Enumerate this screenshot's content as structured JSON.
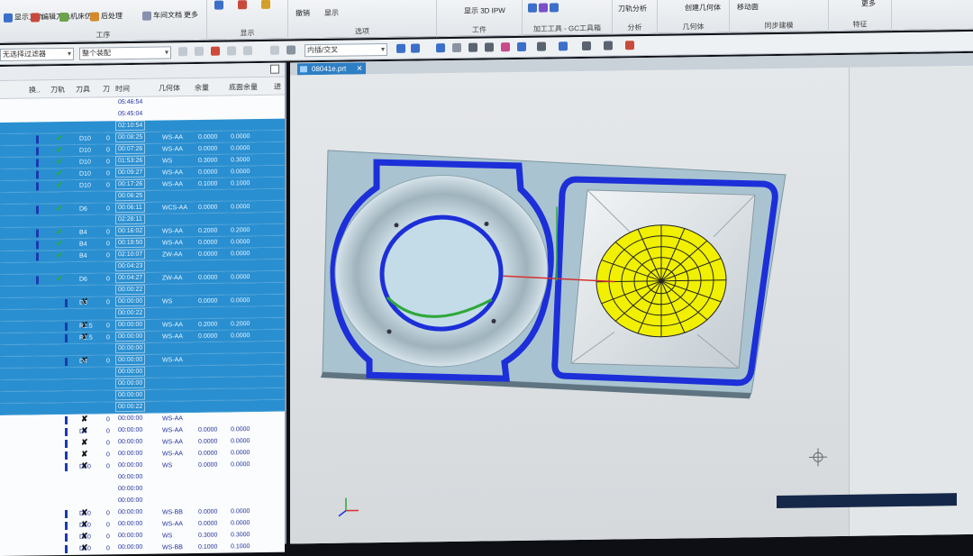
{
  "ribbon": {
    "groups": [
      {
        "name": "工序",
        "buttons": [
          "显示刀轨",
          "编辑刀轨",
          "机床仿真",
          "后处理",
          "车间文档",
          "更多"
        ]
      },
      {
        "name": "显示",
        "buttons": []
      },
      {
        "name": "选项",
        "buttons": [
          "撤销",
          "显示"
        ]
      },
      {
        "name": "工件",
        "buttons": [
          "显示 3D IPW"
        ]
      },
      {
        "name": "加工工具 - GC工具箱",
        "buttons": []
      },
      {
        "name": "分析",
        "buttons": [
          "刀轨分析"
        ]
      },
      {
        "name": "几何体",
        "buttons": [
          "创建几何体"
        ]
      },
      {
        "name": "同步建模",
        "buttons": [
          "移动面"
        ]
      },
      {
        "name": "特征",
        "buttons": [
          "更多"
        ]
      }
    ]
  },
  "toolbar": {
    "filter_value": "无选择过滤器",
    "assembly_value": "整个装配",
    "snap_value": "内插/交叉"
  },
  "navigator": {
    "columns": [
      "换..",
      "刀轨",
      "刀具",
      "刀",
      "时间",
      "几何体",
      "余量",
      "底面余量",
      "进"
    ],
    "rows": [
      {
        "sel": false,
        "time": "05:46:54",
        "mark": "",
        "tool": "",
        "n": "",
        "geo": "",
        "a": "",
        "b": ""
      },
      {
        "sel": false,
        "time": "05:45:04",
        "mark": "",
        "tool": "",
        "n": "",
        "geo": "",
        "a": "",
        "b": ""
      },
      {
        "sel": true,
        "time": "02:10:54",
        "mark": "",
        "tool": "",
        "n": "",
        "geo": "",
        "a": "",
        "b": ""
      },
      {
        "sel": true,
        "time": "00:08:25",
        "mark": "check",
        "tool": "D10",
        "n": "0",
        "geo": "WS-AA",
        "a": "0.0000",
        "b": "0.0000"
      },
      {
        "sel": true,
        "time": "00:07:26",
        "mark": "check",
        "tool": "D10",
        "n": "0",
        "geo": "WS-AA",
        "a": "0.0000",
        "b": "0.0000"
      },
      {
        "sel": true,
        "time": "01:53:26",
        "mark": "check",
        "tool": "D10",
        "n": "0",
        "geo": "WS",
        "a": "0.3000",
        "b": "0.3000"
      },
      {
        "sel": true,
        "time": "00:09:27",
        "mark": "check",
        "tool": "D10",
        "n": "0",
        "geo": "WS-AA",
        "a": "0.0000",
        "b": "0.0000"
      },
      {
        "sel": true,
        "time": "00:17:26",
        "mark": "check",
        "tool": "D10",
        "n": "0",
        "geo": "WS-AA",
        "a": "0.1000",
        "b": "0.1000"
      },
      {
        "sel": true,
        "time": "00:06:25",
        "mark": "",
        "tool": "",
        "n": "",
        "geo": "",
        "a": "",
        "b": ""
      },
      {
        "sel": true,
        "time": "00:06:11",
        "mark": "check",
        "tool": "D6",
        "n": "0",
        "geo": "WCS-AA",
        "a": "0.0000",
        "b": "0.0000"
      },
      {
        "sel": true,
        "time": "02:28:11",
        "mark": "",
        "tool": "",
        "n": "",
        "geo": "",
        "a": "",
        "b": ""
      },
      {
        "sel": true,
        "time": "00:16:02",
        "mark": "check",
        "tool": "B4",
        "n": "0",
        "geo": "WS-AA",
        "a": "0.2000",
        "b": "0.2000"
      },
      {
        "sel": true,
        "time": "00:19:50",
        "mark": "check",
        "tool": "B4",
        "n": "0",
        "geo": "WS-AA",
        "a": "0.0000",
        "b": "0.0000"
      },
      {
        "sel": true,
        "time": "02:10:07",
        "mark": "check",
        "tool": "B4",
        "n": "0",
        "geo": "ZW-AA",
        "a": "0.0000",
        "b": "0.0000"
      },
      {
        "sel": true,
        "time": "00:04:23",
        "mark": "",
        "tool": "",
        "n": "",
        "geo": "",
        "a": "",
        "b": ""
      },
      {
        "sel": true,
        "time": "00:04:27",
        "mark": "check",
        "tool": "D6",
        "n": "0",
        "geo": "ZW-AA",
        "a": "0.0000",
        "b": "0.0000"
      },
      {
        "sel": true,
        "time": "00:00:22",
        "mark": "",
        "tool": "",
        "n": "",
        "geo": "",
        "a": "",
        "b": ""
      },
      {
        "sel": true,
        "time": "00:00:00",
        "mark": "x",
        "tool": "D3",
        "n": "0",
        "geo": "WS",
        "a": "0.0000",
        "b": "0.0000"
      },
      {
        "sel": true,
        "time": "00:00:22",
        "mark": "",
        "tool": "",
        "n": "",
        "geo": "",
        "a": "",
        "b": ""
      },
      {
        "sel": true,
        "time": "00:00:00",
        "mark": "x",
        "tool": "R1.5",
        "n": "0",
        "geo": "WS-AA",
        "a": "0.2000",
        "b": "0.2000"
      },
      {
        "sel": true,
        "time": "00:00:00",
        "mark": "x",
        "tool": "R1.5",
        "n": "0",
        "geo": "WS-AA",
        "a": "0.0000",
        "b": "0.0000"
      },
      {
        "sel": true,
        "time": "00:00:00",
        "mark": "",
        "tool": "",
        "n": "",
        "geo": "",
        "a": "",
        "b": ""
      },
      {
        "sel": true,
        "time": "00:00:00",
        "mark": "x",
        "tool": "D4",
        "n": "0",
        "geo": "WS-AA",
        "a": "",
        "b": ""
      },
      {
        "sel": true,
        "time": "00:00:00",
        "mark": "",
        "tool": "",
        "n": "",
        "geo": "",
        "a": "",
        "b": ""
      },
      {
        "sel": true,
        "time": "00:00:00",
        "mark": "",
        "tool": "",
        "n": "",
        "geo": "",
        "a": "",
        "b": ""
      },
      {
        "sel": true,
        "time": "00:00:00",
        "mark": "",
        "tool": "",
        "n": "",
        "geo": "",
        "a": "",
        "b": ""
      },
      {
        "sel": true,
        "time": "00:00:22",
        "mark": "",
        "tool": "",
        "n": "",
        "geo": "",
        "a": "",
        "b": ""
      },
      {
        "sel": false,
        "time": "00:00:00",
        "mark": "x",
        "tool": "",
        "n": "0",
        "geo": "WS-AA",
        "a": "",
        "b": ""
      },
      {
        "sel": false,
        "time": "00:00:00",
        "mark": "x",
        "tool": "D4",
        "n": "0",
        "geo": "WS-AA",
        "a": "0.0000",
        "b": "0.0000"
      },
      {
        "sel": false,
        "time": "00:00:00",
        "mark": "x",
        "tool": "",
        "n": "0",
        "geo": "WS-AA",
        "a": "0.0000",
        "b": "0.0000"
      },
      {
        "sel": false,
        "time": "00:00:00",
        "mark": "x",
        "tool": "",
        "n": "0",
        "geo": "WS-AA",
        "a": "0.0000",
        "b": "0.0000"
      },
      {
        "sel": false,
        "time": "00:00:00",
        "mark": "x",
        "tool": "D10",
        "n": "0",
        "geo": "WS",
        "a": "0.0000",
        "b": "0.0000"
      },
      {
        "sel": false,
        "time": "00:00:00",
        "mark": "",
        "tool": "",
        "n": "",
        "geo": "",
        "a": "",
        "b": ""
      },
      {
        "sel": false,
        "time": "00:00:00",
        "mark": "",
        "tool": "",
        "n": "",
        "geo": "",
        "a": "",
        "b": ""
      },
      {
        "sel": false,
        "time": "00:00:00",
        "mark": "",
        "tool": "",
        "n": "",
        "geo": "",
        "a": "",
        "b": ""
      },
      {
        "sel": false,
        "time": "00:00:00",
        "mark": "x",
        "tool": "D10",
        "n": "0",
        "geo": "WS-BB",
        "a": "0.0000",
        "b": "0.0000"
      },
      {
        "sel": false,
        "time": "00:00:00",
        "mark": "x",
        "tool": "D10",
        "n": "0",
        "geo": "WS-AA",
        "a": "0.0000",
        "b": "0.0000"
      },
      {
        "sel": false,
        "time": "00:00:00",
        "mark": "x",
        "tool": "D10",
        "n": "0",
        "geo": "WS",
        "a": "0.3000",
        "b": "0.3000"
      },
      {
        "sel": false,
        "time": "00:00:00",
        "mark": "x",
        "tool": "D10",
        "n": "0",
        "geo": "WS-BB",
        "a": "0.1000",
        "b": "0.1000"
      }
    ]
  },
  "graphics": {
    "tab_label": "08041e.prt",
    "tab_close": "✕",
    "status_text": "",
    "colors": {
      "part": "#a9c4d0",
      "outline": "#1c2fd8",
      "toolpath": "#f0f000"
    }
  }
}
